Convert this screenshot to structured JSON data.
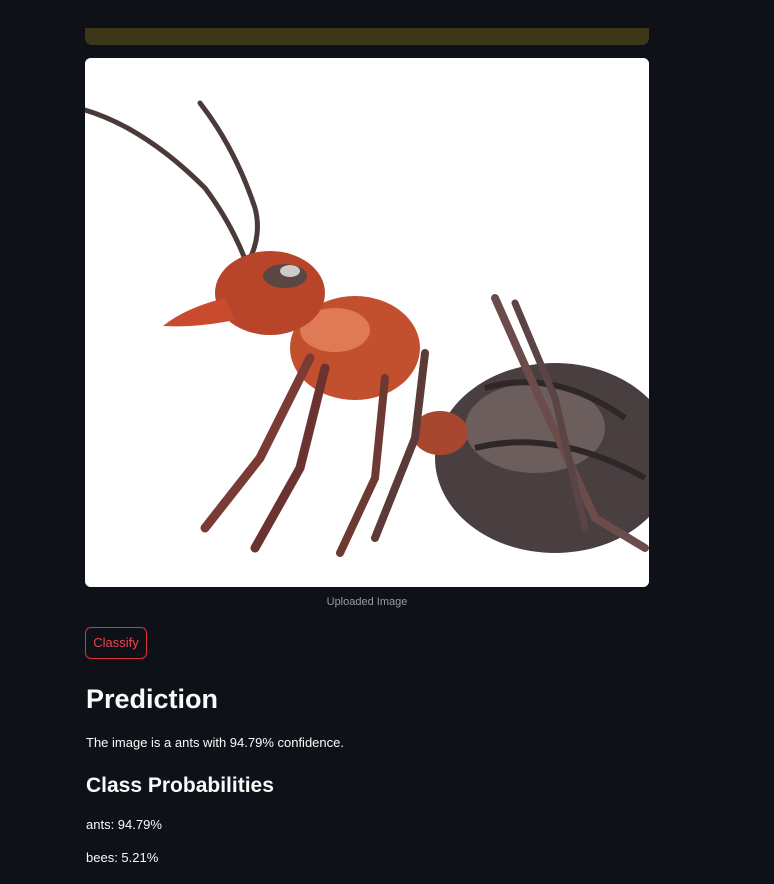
{
  "image_caption": "Uploaded Image",
  "classify_label": "Classify",
  "prediction_heading": "Prediction",
  "prediction_text": "The image is a ants with 94.79% confidence.",
  "probabilities_heading": "Class Probabilities",
  "probabilities": [
    {
      "text": "ants: 94.79%"
    },
    {
      "text": "bees: 5.21%"
    }
  ],
  "colors": {
    "background": "#0e1117",
    "accent": "#ff4b4b",
    "notice": "#3b3718"
  }
}
